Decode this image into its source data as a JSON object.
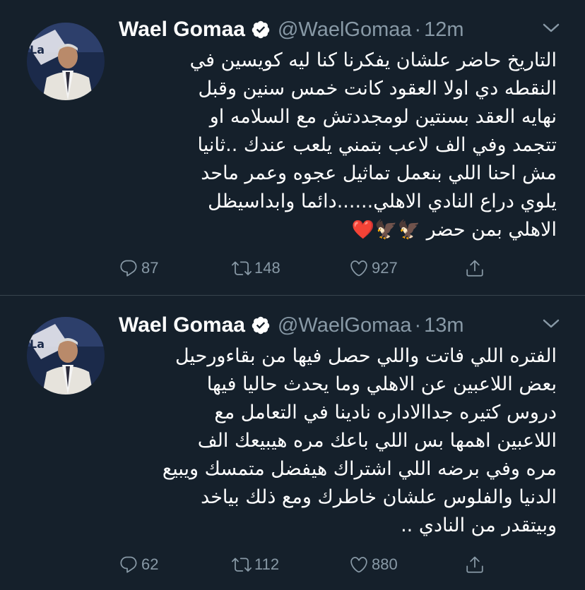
{
  "tweets": [
    {
      "author": {
        "name": "Wael Gomaa",
        "handle": "@WaelGomaa",
        "verified": true,
        "avatar_badge_text": "La"
      },
      "separator": "·",
      "time": "12m",
      "lines": [
        "التاريخ حاضر علشان  يفكرنا كنا ليه كويسين في",
        "النقطه دي اولا العقود كانت خمس سنين وقبل",
        "نهايه العقد بسنتين لومجددتش مع السلامه او",
        "تتجمد وفي الف لاعب بتمني يلعب عندك ..ثانيا",
        "مش احنا اللي بنعمل تماثيل عجوه  وعمر ماحد",
        "يلوي دراع النادي الاهلي......دائما وابداسيظل",
        "الاهلي بمن حضر"
      ],
      "emojis": "🦅🦅❤️",
      "stats": {
        "replies": "87",
        "retweets": "148",
        "likes": "927"
      }
    },
    {
      "author": {
        "name": "Wael Gomaa",
        "handle": "@WaelGomaa",
        "verified": true,
        "avatar_badge_text": "La"
      },
      "separator": "·",
      "time": "13m",
      "lines": [
        "الفتره اللي فاتت واللي حصل فيها من بقاءورحيل",
        "بعض اللاعبين عن الاهلي وما يحدث حاليا فيها",
        "دروس كتيره جداالاداره نادينا في التعامل مع",
        "اللاعبين  اهمها بس اللي باعك مره هيبيعك الف",
        "مره  وفي برضه اللي اشتراك هيفضل متمسك ويبيع",
        "الدنيا والفلوس علشان خاطرك ومع ذلك بياخد",
        "وبيتقدر من النادي .."
      ],
      "emojis": "",
      "stats": {
        "replies": "62",
        "retweets": "112",
        "likes": "880"
      }
    }
  ],
  "colors": {
    "background": "#15202b",
    "divider": "#38444d",
    "secondary_text": "#8899a6",
    "verified_badge": "#ffffff"
  },
  "icons": {
    "reply": "reply-icon",
    "retweet": "retweet-icon",
    "like": "like-icon",
    "share": "share-icon",
    "caret": "chevron-down-icon",
    "verified": "verified-badge-icon"
  }
}
